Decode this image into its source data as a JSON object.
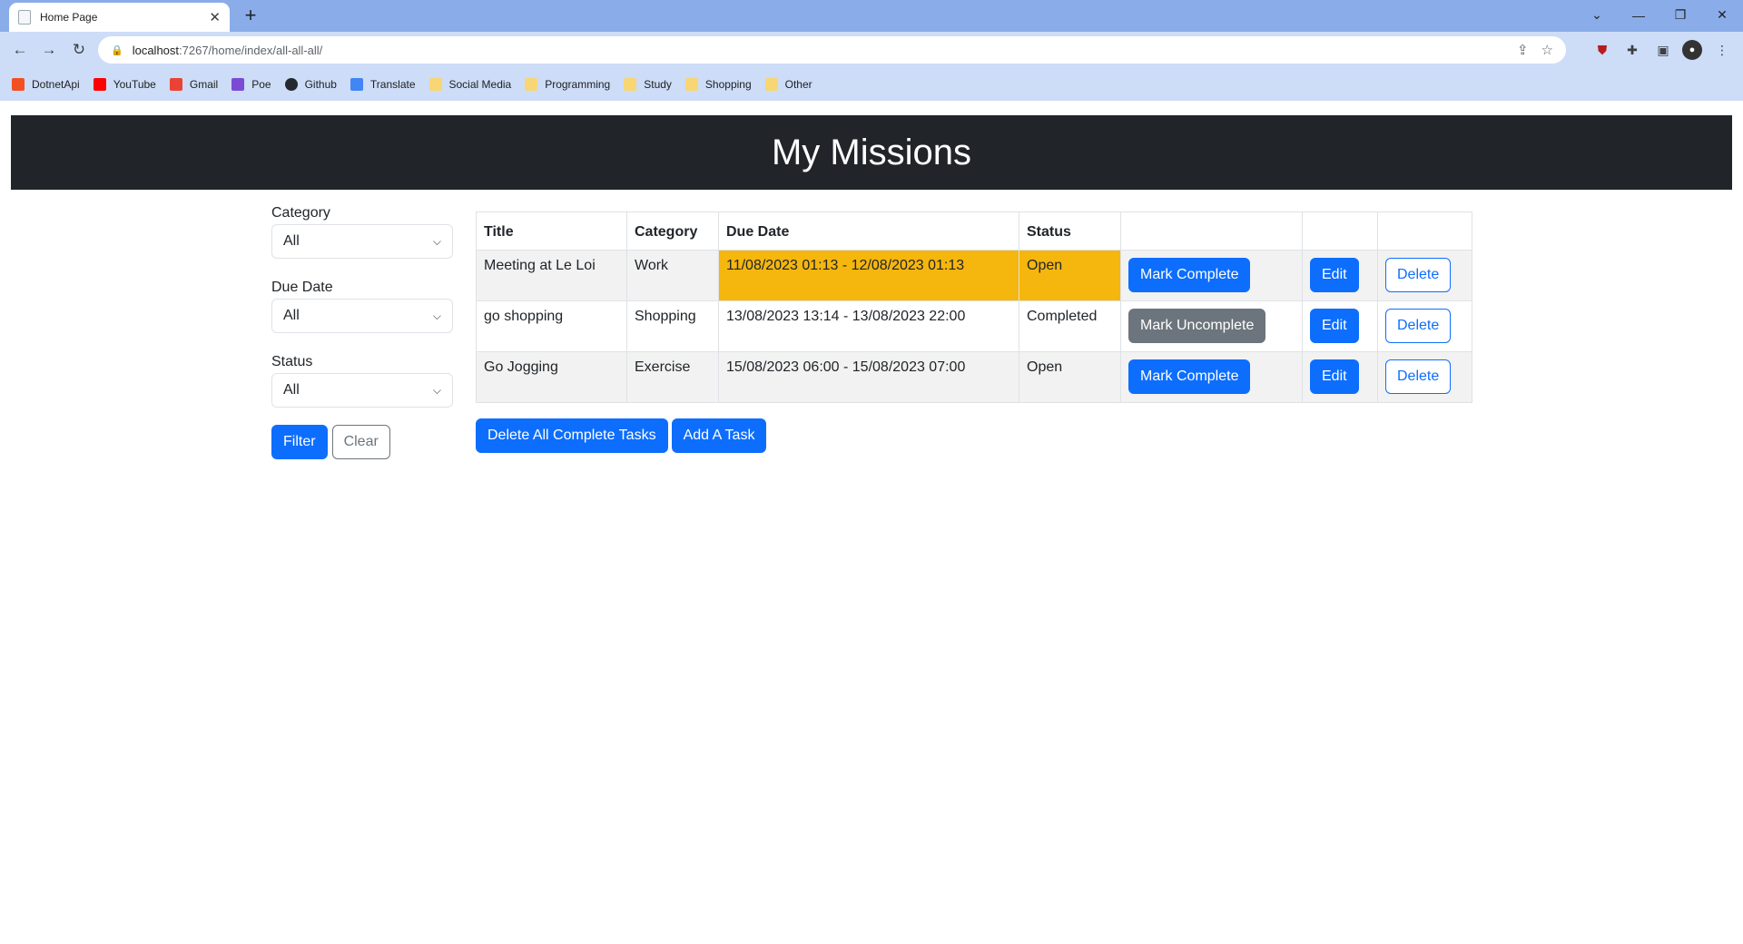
{
  "browser": {
    "tab_title": "Home Page",
    "url_host": "localhost",
    "url_rest": ":7267/home/index/all-all-all/",
    "bookmarks": [
      {
        "label": "DotnetApi",
        "color": "#f25022"
      },
      {
        "label": "YouTube",
        "color": "#ff0000"
      },
      {
        "label": "Gmail",
        "color": "#ea4335"
      },
      {
        "label": "Poe",
        "color": "#7b4bd6"
      },
      {
        "label": "Github",
        "color": "#24292f"
      },
      {
        "label": "Translate",
        "color": "#4285f4"
      },
      {
        "label": "Social Media",
        "color": "#f7d774"
      },
      {
        "label": "Programming",
        "color": "#f7d774"
      },
      {
        "label": "Study",
        "color": "#f7d774"
      },
      {
        "label": "Shopping",
        "color": "#f7d774"
      },
      {
        "label": "Other",
        "color": "#f7d774"
      }
    ]
  },
  "header": {
    "title": "My Missions"
  },
  "filters": {
    "category_label": "Category",
    "category_value": "All",
    "due_label": "Due Date",
    "due_value": "All",
    "status_label": "Status",
    "status_value": "All",
    "filter_button": "Filter",
    "clear_button": "Clear"
  },
  "table": {
    "headers": [
      "Title",
      "Category",
      "Due Date",
      "Status"
    ],
    "rows": [
      {
        "title": "Meeting at Le Loi",
        "category": "Work",
        "due": "11/08/2023 01:13 - 12/08/2023 01:13",
        "status": "Open",
        "toggle": "Mark Complete",
        "edit": "Edit",
        "delete": "Delete"
      },
      {
        "title": "go shopping",
        "category": "Shopping",
        "due": "13/08/2023 13:14 - 13/08/2023 22:00",
        "status": "Completed",
        "toggle": "Mark Uncomplete",
        "edit": "Edit",
        "delete": "Delete"
      },
      {
        "title": "Go Jogging",
        "category": "Exercise",
        "due": "15/08/2023 06:00 - 15/08/2023 07:00",
        "status": "Open",
        "toggle": "Mark Complete",
        "edit": "Edit",
        "delete": "Delete"
      }
    ]
  },
  "actions": {
    "delete_complete": "Delete All Complete Tasks",
    "add_task": "Add A Task"
  },
  "colors": {
    "overdue": "#f5b60e",
    "primary": "#0d6efd",
    "secondary": "#6c757d",
    "header_bg": "#212529"
  }
}
